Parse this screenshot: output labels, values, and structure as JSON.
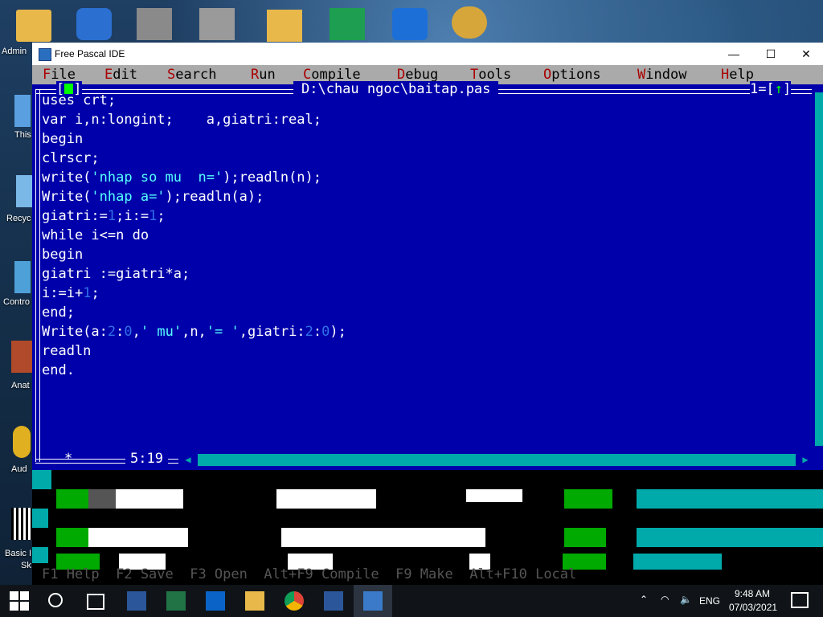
{
  "desktop": {
    "labels": [
      "Admin",
      "This",
      "Recyc",
      "Contro",
      "Anat",
      "Aud",
      "Basic I",
      "Sk"
    ]
  },
  "window": {
    "title": "Free Pascal IDE",
    "controls": [
      "—",
      "☐",
      "✕"
    ]
  },
  "menu": [
    {
      "hot": "F",
      "rest": "ile"
    },
    {
      "hot": "E",
      "rest": "dit"
    },
    {
      "hot": "S",
      "rest": "earch"
    },
    {
      "hot": "R",
      "rest": "un"
    },
    {
      "hot": "C",
      "rest": "ompile"
    },
    {
      "hot": "D",
      "rest": "ebug"
    },
    {
      "hot": "T",
      "rest": "ools"
    },
    {
      "hot": "O",
      "rest": "ptions"
    },
    {
      "hot": "W",
      "rest": "indow"
    },
    {
      "hot": "H",
      "rest": "elp"
    }
  ],
  "editor": {
    "close_box_left": "[",
    "close_box_right": "]",
    "file_title": "D:\\chau ngoc\\baitap.pas",
    "window_number": "1=[",
    "window_arrow": "↑",
    "window_number_end": "]",
    "modified": "*",
    "cursor_pos": "5:19",
    "code": [
      [
        {
          "t": "uses crt;"
        }
      ],
      [
        {
          "t": "var i,n:longint;    a,giatri:real;"
        }
      ],
      [
        {
          "t": "begin"
        }
      ],
      [
        {
          "t": "clrscr;"
        }
      ],
      [
        {
          "t": "write("
        },
        {
          "t": "'nhap so mu  n='",
          "c": "str"
        },
        {
          "t": ");readln(n);"
        }
      ],
      [
        {
          "t": "Write("
        },
        {
          "t": "'nhap a='",
          "c": "str"
        },
        {
          "t": ");readln(a);"
        }
      ],
      [
        {
          "t": "giatri:="
        },
        {
          "t": "1",
          "c": "num"
        },
        {
          "t": ";i:="
        },
        {
          "t": "1",
          "c": "num"
        },
        {
          "t": ";"
        }
      ],
      [
        {
          "t": "while i<=n do"
        }
      ],
      [
        {
          "t": "begin"
        }
      ],
      [
        {
          "t": "giatri :=giatri*a;"
        }
      ],
      [
        {
          "t": "i:=i+"
        },
        {
          "t": "1",
          "c": "num"
        },
        {
          "t": ";"
        }
      ],
      [
        {
          "t": "end;"
        }
      ],
      [
        {
          "t": "Write(a:"
        },
        {
          "t": "2",
          "c": "num"
        },
        {
          "t": ":"
        },
        {
          "t": "0",
          "c": "num"
        },
        {
          "t": ","
        },
        {
          "t": "' mu'",
          "c": "str"
        },
        {
          "t": ",n,"
        },
        {
          "t": "'= '",
          "c": "str"
        },
        {
          "t": ",giatri:"
        },
        {
          "t": "2",
          "c": "num"
        },
        {
          "t": ":"
        },
        {
          "t": "0",
          "c": "num"
        },
        {
          "t": ");"
        }
      ],
      [
        {
          "t": "readln"
        }
      ],
      [
        {
          "t": "end."
        }
      ]
    ]
  },
  "hint_line": "F1 Help  F2 Save  F3 Open  Alt+F9 Compile  F9 Make  Alt+F10 Local",
  "taskbar": {
    "language": "ENG",
    "time": "9:48 AM",
    "date": "07/03/2021"
  },
  "colors": {
    "editor_bg": "#0000aa",
    "menubar_bg": "#aaaaaa",
    "hotkey": "#aa0000",
    "string": "#55ffff",
    "number": "#3070e8",
    "scroll": "#00aaaa"
  }
}
